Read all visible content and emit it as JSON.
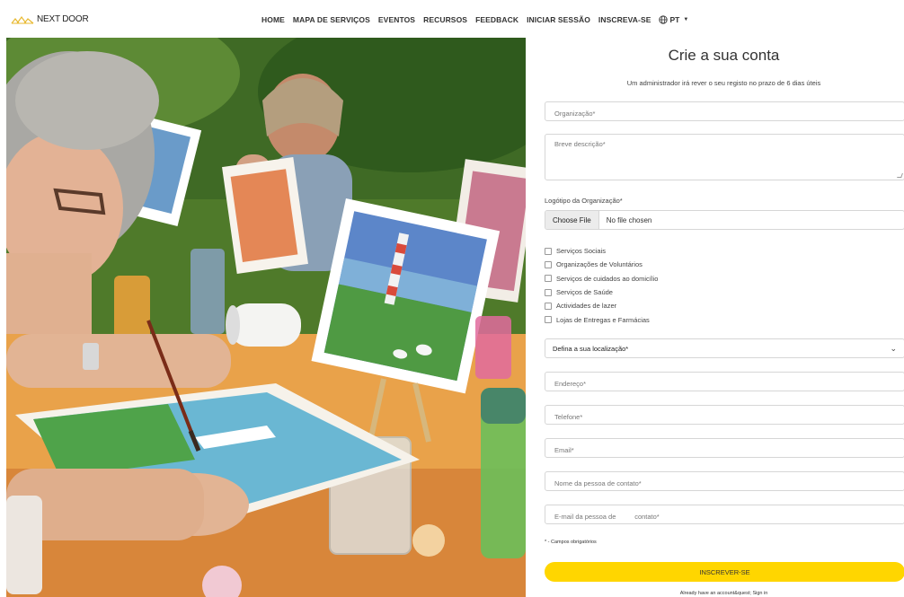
{
  "brand": {
    "name": "NEXT DOOR"
  },
  "nav": {
    "items": [
      "HOME",
      "MAPA DE SERVIÇOS",
      "EVENTOS",
      "RECURSOS",
      "FEEDBACK",
      "INICIAR SESSÃO",
      "INSCREVA-SE"
    ],
    "language": "PT"
  },
  "form": {
    "title": "Crie a sua conta",
    "subtitle": "Um administrador irá rever o seu registo no prazo de 6 dias úteis",
    "organization_placeholder": "Organização*",
    "description_placeholder": "Breve descrição*",
    "logo_label": "Logótipo da Organização*",
    "file_button": "Choose File",
    "file_status": "No file chosen",
    "categories": [
      "Serviços Sociais",
      "Organizações de Voluntários",
      "Serviços de cuidados ao domicílio",
      "Serviços de Saúde",
      "Actividades de lazer",
      "Lojas de Entregas e Farmácias"
    ],
    "location_select": "Defina a sua localização*",
    "address_placeholder": "Endereço*",
    "phone_placeholder": "Telefone*",
    "email_placeholder": "Email*",
    "contact_name_placeholder": "Nome da pessoa de contato*",
    "contact_email_placeholder": "E-mail da pessoa de          contato*",
    "required_note": "* - Campos obrigatórios",
    "submit_label": "INSCREVER-SE",
    "signin_text": "Already have an account&quest; Sign in"
  },
  "colors": {
    "accent": "#ffd600",
    "border": "#d6d6d6"
  },
  "icons": [
    "globe-icon",
    "caret-down-icon",
    "chevron-down-icon",
    "logo-icon"
  ]
}
